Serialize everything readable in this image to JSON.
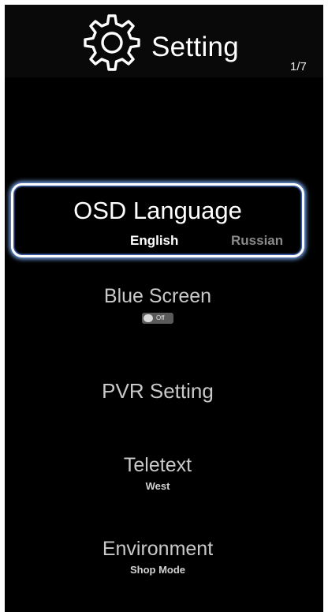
{
  "header": {
    "title": "Setting",
    "page_indicator": "1/7",
    "icon": "gear-icon"
  },
  "menu": {
    "osd_language": {
      "label": "OSD Language",
      "current": "English",
      "next": "Russian",
      "selected": true
    },
    "blue_screen": {
      "label": "Blue Screen",
      "toggle_text": "Off",
      "toggle_state": "off"
    },
    "pvr_setting": {
      "label": "PVR Setting"
    },
    "teletext": {
      "label": "Teletext",
      "value": "West"
    },
    "environment": {
      "label": "Environment",
      "value": "Shop Mode"
    }
  },
  "colors": {
    "background": "#000000",
    "selection_glow": "#7fb3ff",
    "text_primary": "#ffffff",
    "text_dim": "#c9c9c9"
  }
}
